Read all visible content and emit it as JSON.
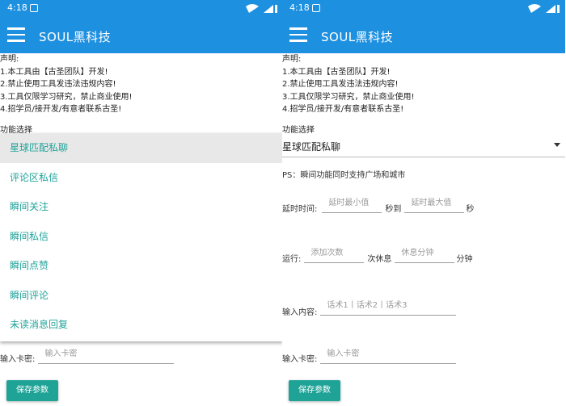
{
  "status": {
    "time": "4:18"
  },
  "app": {
    "title": "SOUL黑科技"
  },
  "notice": {
    "heading": "声明:",
    "lines": [
      "1.本工具由【古圣团队】开发!",
      "2.禁止使用工具发违法违规内容!",
      "3.工具仅限学习研究，禁止商业使用!",
      "4.招学员/接开发/有意者联系古圣!"
    ]
  },
  "function_label": "功能选择",
  "dropdown_options": [
    "星球匹配私聊",
    "评论区私信",
    "瞬间关注",
    "瞬间私信",
    "瞬间点赞",
    "瞬间评论",
    "未读消息回复"
  ],
  "selected_function": "星球匹配私聊",
  "ps_note": "PS：瞬间功能同时支持广场和城市",
  "delay": {
    "label": "延时时间:",
    "min_placeholder": "延时最小值",
    "to": "秒到",
    "max_placeholder": "延时最大值",
    "unit": "秒"
  },
  "run": {
    "label": "运行:",
    "count_placeholder": "添加次数",
    "rest": "次休息",
    "rest_placeholder": "休息分钟",
    "unit": "分钟"
  },
  "input_content": {
    "label": "输入内容:",
    "placeholder": "话术1丨话术2丨话术3"
  },
  "card": {
    "label": "输入卡密:",
    "placeholder": "输入卡密"
  },
  "save_button": "保存参数",
  "colors": {
    "primary": "#1e90e0",
    "accent": "#21a39a",
    "button": "#1fa397"
  }
}
